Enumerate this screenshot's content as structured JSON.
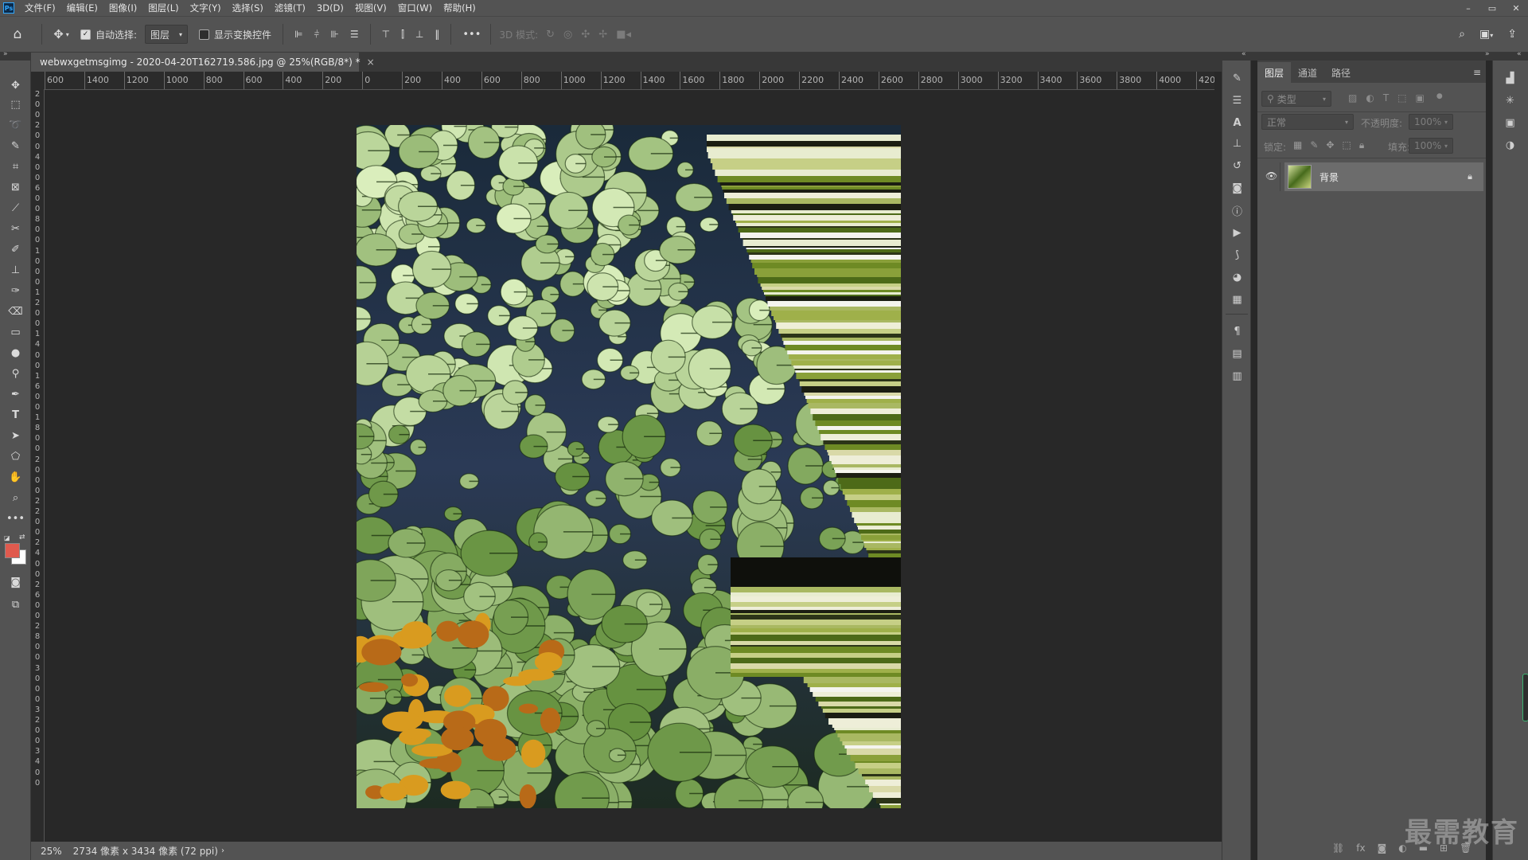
{
  "app": {
    "logo_text": "Ps"
  },
  "menu": [
    "文件(F)",
    "编辑(E)",
    "图像(I)",
    "图层(L)",
    "文字(Y)",
    "选择(S)",
    "滤镜(T)",
    "3D(D)",
    "视图(V)",
    "窗口(W)",
    "帮助(H)"
  ],
  "window_controls": {
    "minimize": "–",
    "restore": "▭",
    "close": "✕"
  },
  "options_bar": {
    "auto_select_label": "自动选择:",
    "auto_select_checked": true,
    "auto_select_target": "图层",
    "show_transform_label": "显示变换控件",
    "show_transform_checked": false,
    "more": "•••",
    "mode_3d_label": "3D 模式:"
  },
  "document": {
    "tab_title": "webwxgetmsgimg - 2020-04-20T162719.586.jpg @ 25%(RGB/8*) *",
    "tab_close": "×"
  },
  "ruler": {
    "top_labels": [
      "600",
      "1400",
      "1200",
      "1000",
      "800",
      "600",
      "400",
      "200",
      "0",
      "200",
      "400",
      "600",
      "800",
      "1000",
      "1200",
      "1400",
      "1600",
      "1800",
      "2000",
      "2200",
      "2400",
      "2600",
      "2800",
      "3000",
      "3200",
      "3400",
      "3600",
      "3800",
      "4000",
      "420"
    ],
    "left_labels": [
      "2",
      "0",
      "0",
      "2",
      "0",
      "0",
      "4",
      "0",
      "0",
      "6",
      "0",
      "0",
      "8",
      "0",
      "0",
      "1",
      "0",
      "0",
      "0",
      "1",
      "2",
      "0",
      "0",
      "1",
      "4",
      "0",
      "0",
      "1",
      "6",
      "0",
      "0",
      "1",
      "8",
      "0",
      "0",
      "2",
      "0",
      "0",
      "0",
      "2",
      "2",
      "0",
      "0",
      "2",
      "4",
      "0",
      "0",
      "2",
      "6",
      "0",
      "0",
      "2",
      "8",
      "0",
      "0",
      "3",
      "0",
      "0",
      "0",
      "3",
      "2",
      "0",
      "0",
      "3",
      "4",
      "0",
      "0"
    ]
  },
  "status": {
    "zoom": "25%",
    "doc_info": "2734 像素 x 3434 像素 (72 ppi)"
  },
  "colors": {
    "foreground": "#e05a4e",
    "background": "#ffffff",
    "chrome": "#535353",
    "canvas_bg": "#282828"
  },
  "panel": {
    "tabs": [
      "图层",
      "通道",
      "路径"
    ],
    "active_tab": "图层",
    "filter_placeholder": "类型",
    "blend_mode": "正常",
    "opacity_label": "不透明度:",
    "opacity_value": "100%",
    "lock_label": "锁定:",
    "fill_label": "填充:",
    "fill_value": "100%",
    "layers": [
      {
        "name": "背景",
        "visible": true,
        "locked": true
      }
    ]
  },
  "watermark": "最需教育"
}
